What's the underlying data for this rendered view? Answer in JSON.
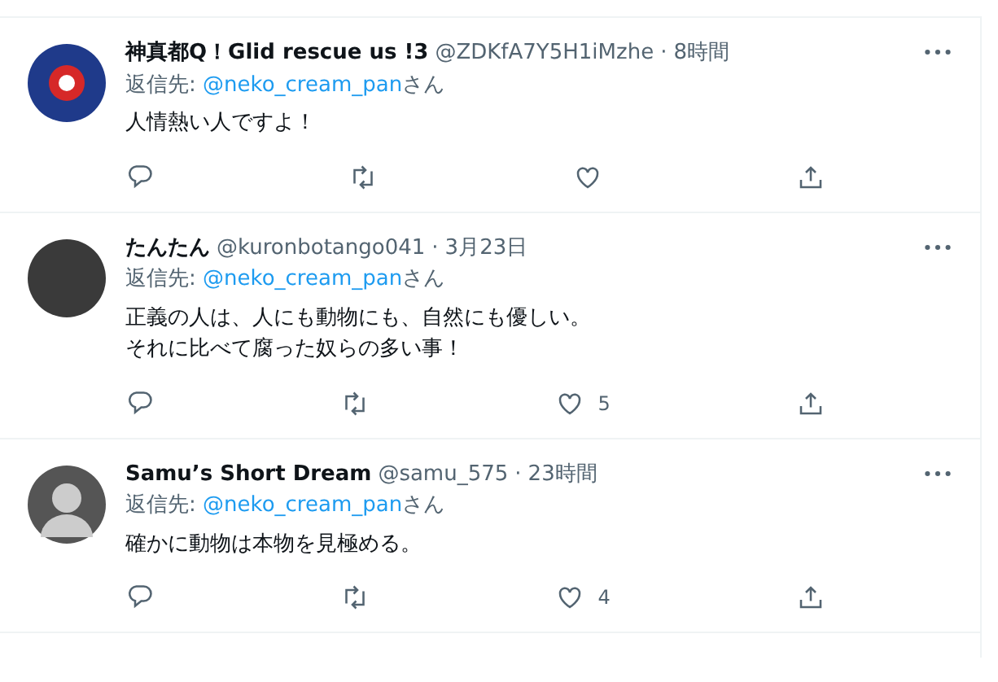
{
  "tweets": [
    {
      "avatar": {
        "kind": "logo"
      },
      "name": "神真都Q！Glid rescue us !3",
      "handle": "@ZDKfA7Y5H1iMzhe",
      "separator": "·",
      "time": "8時間",
      "reply_prefix": "返信先: ",
      "reply_handle": "@neko_cream_pan",
      "reply_suffix": "さん",
      "text_lines": [
        "人情熱い人ですよ！"
      ]
    },
    {
      "avatar": {
        "kind": "photo"
      },
      "name": "たんたん",
      "handle": "@kuronbotango041",
      "separator": "·",
      "time": "3月23日",
      "reply_prefix": "返信先: ",
      "reply_handle": "@neko_cream_pan",
      "reply_suffix": "さん",
      "text_lines": [
        "正義の人は、人にも動物にも、自然にも優しい。",
        "それに比べて腐った奴らの多い事！"
      ],
      "like_count": "5"
    },
    {
      "avatar": {
        "kind": "cartoon"
      },
      "name": "Samu’s Short Dream",
      "handle": "@samu_575",
      "separator": "·",
      "time": "23時間",
      "reply_prefix": "返信先: ",
      "reply_handle": "@neko_cream_pan",
      "reply_suffix": "さん",
      "text_lines": [
        "確かに動物は本物を見極める。"
      ],
      "like_count": "4"
    }
  ]
}
